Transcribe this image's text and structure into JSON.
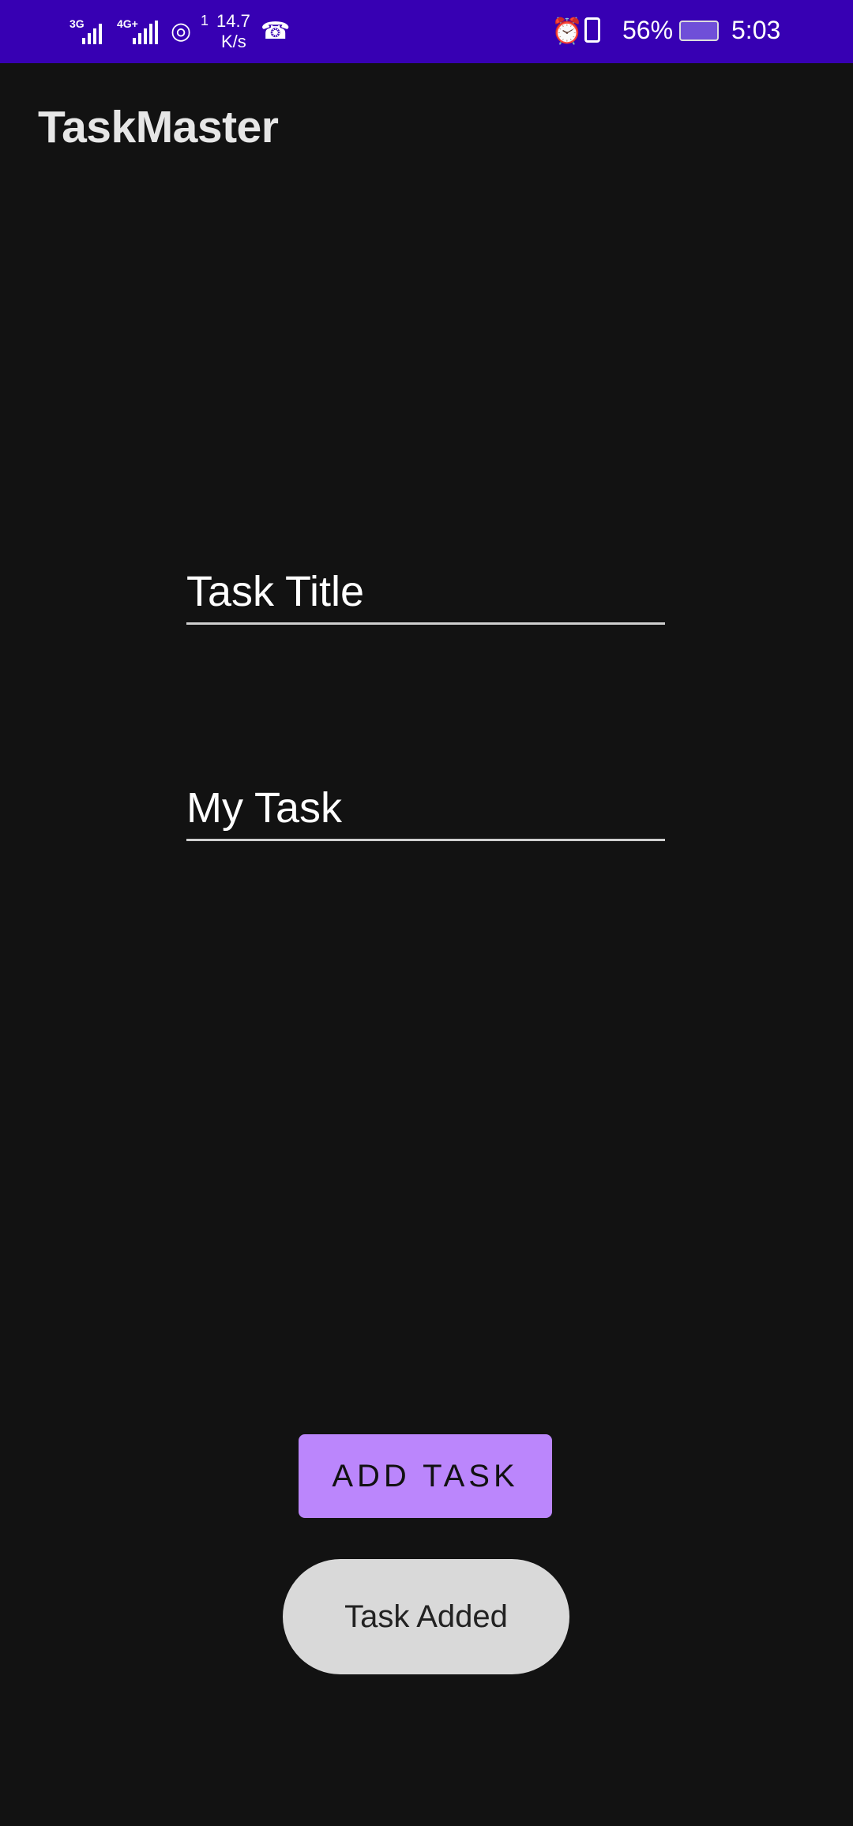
{
  "status_bar": {
    "network1": "3G",
    "network2": "4G+",
    "hotspot_count": "1",
    "speed_value": "14.7",
    "speed_unit": "K/s",
    "battery": "56%",
    "time": "5:03",
    "background_color": "#3700b3"
  },
  "app_bar": {
    "title": "TaskMaster"
  },
  "form": {
    "title_field": {
      "placeholder": "Task Title"
    },
    "description_field": {
      "value": "My Task"
    }
  },
  "add_button": {
    "label": "ADD TASK",
    "color": "#bb86fc"
  },
  "toast": {
    "message": "Task Added"
  }
}
